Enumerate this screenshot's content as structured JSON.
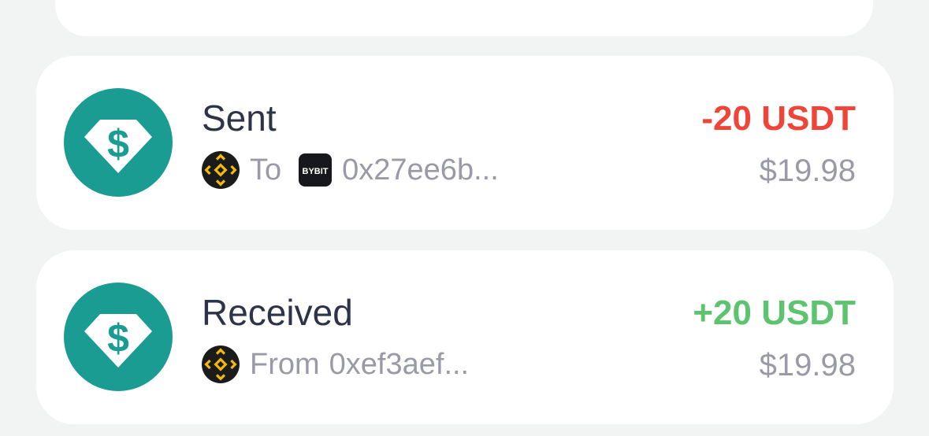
{
  "colors": {
    "negative": "#f04438",
    "positive": "#5cc36f",
    "token_teal": "#1a9c92",
    "chain_gold": "#f0b90b",
    "muted_text": "#9a9aa6",
    "title_text": "#2e3448"
  },
  "transactions": [
    {
      "title": "Sent",
      "token_icon": "usdt-icon",
      "chain_icon": "bnb-chain-icon",
      "direction_label": "To",
      "exchange_icon": "bybit-icon",
      "exchange_logo_text": "BYBIT",
      "address": "0x27ee6b...",
      "amount": "-20 USDT",
      "fiat_value": "$19.98"
    },
    {
      "title": "Received",
      "token_icon": "usdt-icon",
      "chain_icon": "bnb-chain-icon",
      "direction_label": "From",
      "address": "0xef3aef...",
      "amount": "+20 USDT",
      "fiat_value": "$19.98"
    }
  ]
}
